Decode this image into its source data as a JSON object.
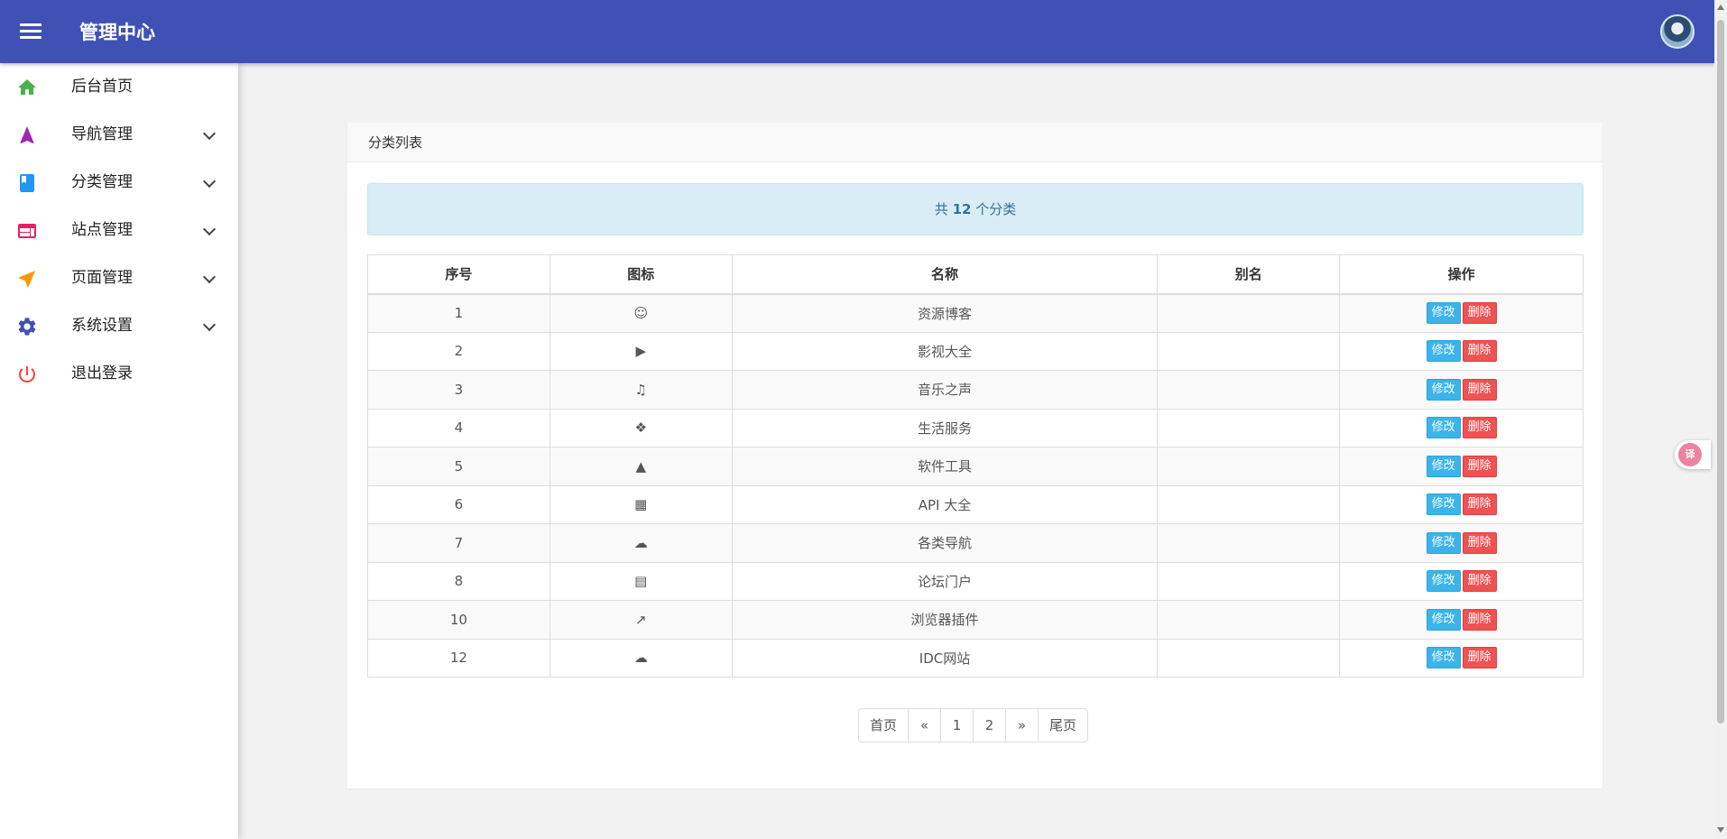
{
  "header": {
    "title": "管理中心",
    "accent_color": "#3f51b5"
  },
  "sidebar": {
    "items": [
      {
        "label": "后台首页",
        "icon": "home-icon",
        "color": "#4caf50",
        "expandable": false
      },
      {
        "label": "导航管理",
        "icon": "navigation-arrow-icon",
        "color": "#9c27b0",
        "expandable": true
      },
      {
        "label": "分类管理",
        "icon": "book-icon",
        "color": "#2196f3",
        "expandable": true
      },
      {
        "label": "站点管理",
        "icon": "web-icon",
        "color": "#e91e63",
        "expandable": true
      },
      {
        "label": "页面管理",
        "icon": "send-icon",
        "color": "#ff9800",
        "expandable": true
      },
      {
        "label": "系统设置",
        "icon": "gear-icon",
        "color": "#3f51b5",
        "expandable": true
      },
      {
        "label": "退出登录",
        "icon": "power-icon",
        "color": "#f44336",
        "expandable": false
      }
    ]
  },
  "panel": {
    "title": "分类列表",
    "alert": {
      "prefix": "共 ",
      "count": "12",
      "suffix": " 个分类"
    }
  },
  "table": {
    "headers": [
      "序号",
      "图标",
      "名称",
      "别名",
      "操作"
    ],
    "rows": [
      {
        "id": "1",
        "icon": "slideshare-icon",
        "glyph": "☺",
        "name": "资源博客",
        "alias": ""
      },
      {
        "id": "2",
        "icon": "youtube-play-icon",
        "glyph": "▶",
        "name": "影视大全",
        "alias": ""
      },
      {
        "id": "3",
        "icon": "music-icon",
        "glyph": "♫",
        "name": "音乐之声",
        "alias": ""
      },
      {
        "id": "4",
        "icon": "cubes-icon",
        "glyph": "❖",
        "name": "生活服务",
        "alias": ""
      },
      {
        "id": "5",
        "icon": "graduation-cap-icon",
        "glyph": "▲",
        "name": "软件工具",
        "alias": ""
      },
      {
        "id": "6",
        "icon": "windows-icon",
        "glyph": "▦",
        "name": "API 大全",
        "alias": ""
      },
      {
        "id": "7",
        "icon": "cloud-icon",
        "glyph": "☁",
        "name": "各类导航",
        "alias": ""
      },
      {
        "id": "8",
        "icon": "file-text-icon",
        "glyph": "▤",
        "name": "论坛门户",
        "alias": ""
      },
      {
        "id": "10",
        "icon": "line-chart-icon",
        "glyph": "↗",
        "name": "浏览器插件",
        "alias": ""
      },
      {
        "id": "12",
        "icon": "cloud-icon",
        "glyph": "☁",
        "name": "IDC网站",
        "alias": ""
      }
    ],
    "edit_label": "修改",
    "delete_label": "删除",
    "edit_color": "#3bb4ea",
    "delete_color": "#ef5252"
  },
  "pagination": {
    "first": "首页",
    "prev": "«",
    "pages": [
      "1",
      "2"
    ],
    "next": "»",
    "last": "尾页"
  },
  "floating": {
    "translate_label": "译"
  }
}
